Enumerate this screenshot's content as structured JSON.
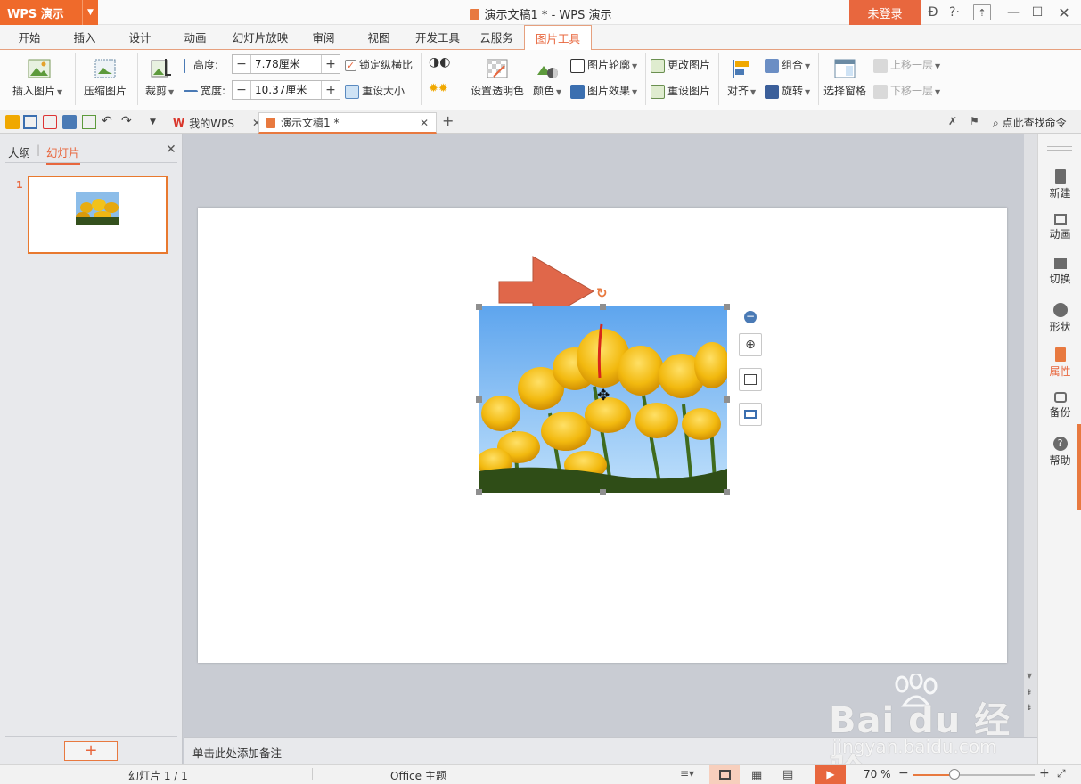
{
  "app": {
    "name": "WPS 演示",
    "doc_title": "演示文稿1 * - WPS 演示",
    "login": "未登录"
  },
  "ribbon_tabs": [
    "开始",
    "插入",
    "设计",
    "动画",
    "幻灯片放映",
    "审阅",
    "视图",
    "开发工具",
    "云服务",
    "图片工具"
  ],
  "active_tab": "图片工具",
  "ribbon": {
    "insert_picture": "插入图片",
    "compress_picture": "压缩图片",
    "crop": "裁剪",
    "height_label": "高度:",
    "height_value": "7.78厘米",
    "width_label": "宽度:",
    "width_value": "10.37厘米",
    "lock_ratio": "锁定纵横比",
    "reset_size": "重设大小",
    "set_transparent": "设置透明色",
    "color": "颜色",
    "picture_outline": "图片轮廓",
    "picture_effect": "图片效果",
    "change_picture": "更改图片",
    "reset_picture": "重设图片",
    "align": "对齐",
    "group": "组合",
    "rotate": "旋转",
    "selection_pane": "选择窗格",
    "bring_forward": "上移一层",
    "send_backward": "下移一层"
  },
  "doc_tabs": [
    {
      "label": "我的WPS"
    },
    {
      "label": "演示文稿1 *"
    }
  ],
  "find_command": "点此查找命令",
  "left_panel": {
    "tab_outline": "大纲",
    "tab_slides": "幻灯片",
    "slide_number": "1"
  },
  "notes_placeholder": "单击此处添加备注",
  "right_panel": [
    "新建",
    "动画",
    "切换",
    "形状",
    "属性",
    "备份",
    "帮助"
  ],
  "status": {
    "slide_info": "幻灯片 1 / 1",
    "theme": "Office 主题",
    "zoom": "70 %"
  },
  "watermark": {
    "brand": "Bai du 经验",
    "url": "jingyan.baidu.com"
  },
  "colors": {
    "accent": "#e8673e",
    "app_orange": "#ef6a2b",
    "arrow": "#e0674a",
    "panel": "#e8e9ec"
  }
}
